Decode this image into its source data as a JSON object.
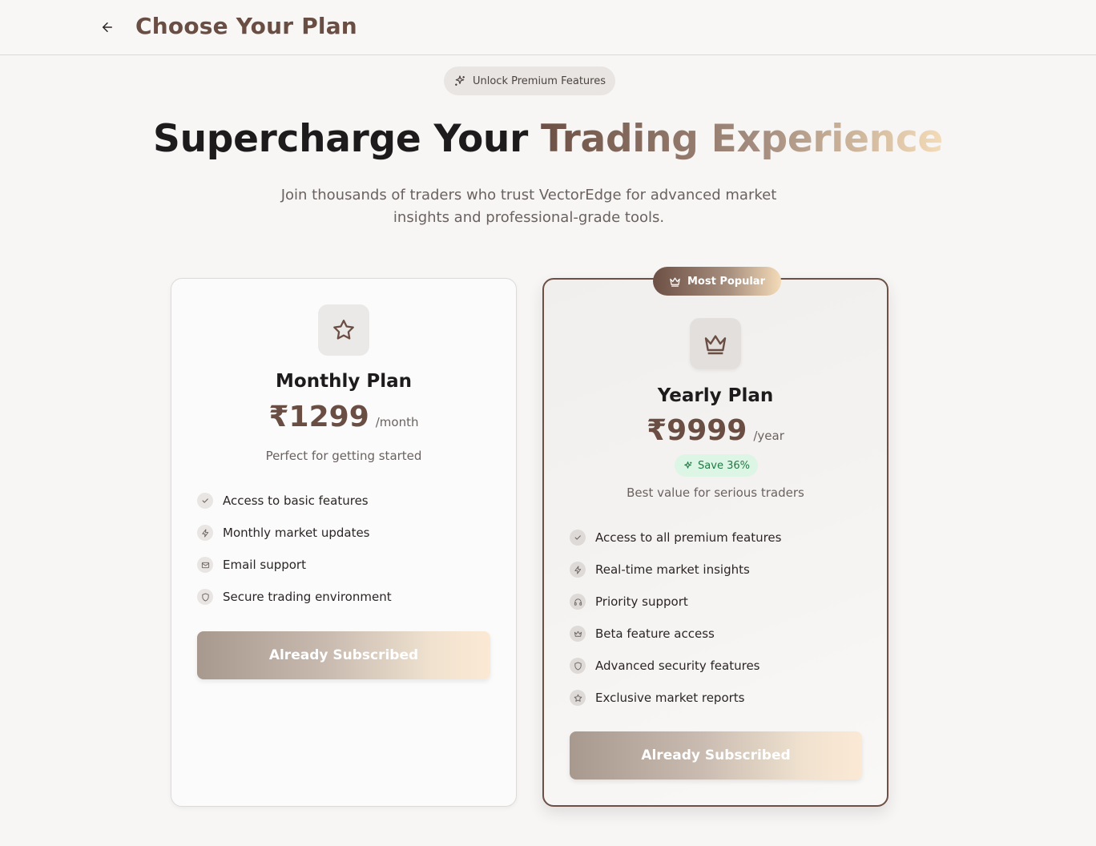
{
  "header": {
    "back_icon": "arrow-left-icon",
    "title": "Choose Your Plan"
  },
  "promo_badge": {
    "icon": "sparkles-icon",
    "label": "Unlock Premium Features"
  },
  "hero": {
    "title_plain": "Supercharge Your ",
    "title_highlight": "Trading Experience",
    "subtitle": "Join thousands of traders who trust VectorEdge for advanced market insights and professional-grade tools."
  },
  "plans": [
    {
      "icon": "star-icon",
      "name": "Monthly Plan",
      "price": "₹1299",
      "period": "/month",
      "description": "Perfect for getting started",
      "features": [
        {
          "icon": "check-icon",
          "label": "Access to basic features"
        },
        {
          "icon": "zap-icon",
          "label": "Monthly market updates"
        },
        {
          "icon": "mail-icon",
          "label": "Email support"
        },
        {
          "icon": "shield-icon",
          "label": "Secure trading environment"
        }
      ],
      "button_label": "Already Subscribed"
    },
    {
      "badge": {
        "icon": "crown-icon",
        "label": "Most Popular"
      },
      "icon": "crown-icon",
      "name": "Yearly Plan",
      "price": "₹9999",
      "period": "/year",
      "savings": {
        "icon": "sparkles-icon",
        "label": "Save 36%"
      },
      "description": "Best value for serious traders",
      "features": [
        {
          "icon": "check-icon",
          "label": "Access to all premium features"
        },
        {
          "icon": "zap-icon",
          "label": "Real-time market insights"
        },
        {
          "icon": "headphones-icon",
          "label": "Priority support"
        },
        {
          "icon": "crown-icon",
          "label": "Beta feature access"
        },
        {
          "icon": "shield-icon",
          "label": "Advanced security features"
        },
        {
          "icon": "star-icon",
          "label": "Exclusive market reports"
        }
      ],
      "button_label": "Already Subscribed"
    }
  ],
  "colors": {
    "brand": "#6a4e43",
    "highlight_start": "#6d5045",
    "highlight_end": "#f4dbb8",
    "savings_bg": "#dcf5e4",
    "savings_text": "#1f7a45"
  }
}
